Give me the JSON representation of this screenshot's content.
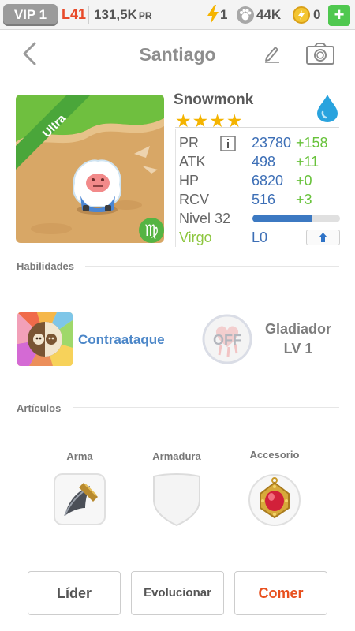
{
  "topbar": {
    "vip": "VIP 1",
    "level": "L41",
    "power_value": "131,5K",
    "power_unit": "PR",
    "energy": "1",
    "paws": "44K",
    "coins": "0",
    "plus": "+"
  },
  "header": {
    "title": "Santiago"
  },
  "pet": {
    "name": "Snowmonk",
    "rarity": "Ultra",
    "stars": "★★★★",
    "star_count": 4,
    "stats": [
      {
        "label": "PR",
        "value": "23780",
        "bonus": "+158"
      },
      {
        "label": "ATK",
        "value": "498",
        "bonus": "+11"
      },
      {
        "label": "HP",
        "value": "6820",
        "bonus": "+0"
      },
      {
        "label": "RCV",
        "value": "516",
        "bonus": "+3"
      }
    ],
    "level_label": "Nivel 32",
    "level_progress": 0.68,
    "sign": "Virgo",
    "sign_level": "L0",
    "zodiac_glyph": "♍",
    "element_color": "#29a3de"
  },
  "skills": {
    "section_title": "Habilidades",
    "skill_name": "Contraataque",
    "off_label": "OFF",
    "passive_name": "Gladiador",
    "passive_level": "LV 1"
  },
  "items": {
    "section_title": "Artículos",
    "weapon": "Arma",
    "armor": "Armadura",
    "accessory": "Accesorio"
  },
  "actions": {
    "leader": "Líder",
    "evolve": "Evolucionar",
    "eat": "Comer"
  }
}
